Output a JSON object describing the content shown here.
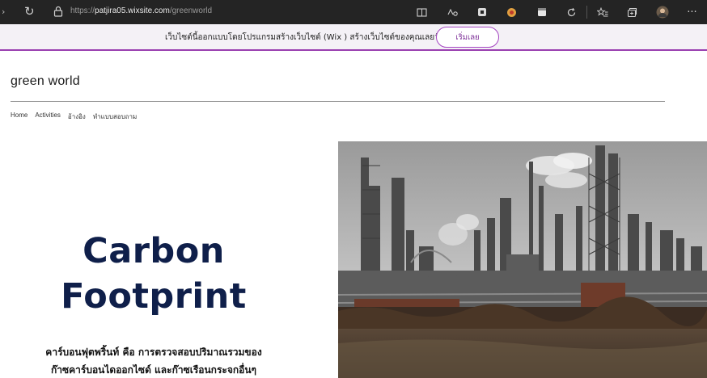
{
  "browser": {
    "url_scheme": "https://",
    "url_host": "patjira05.wixsite.com",
    "url_path": "/greenworld",
    "more_label": "···"
  },
  "wix_banner": {
    "text": "เว็บไซต์นี้ออกแบบโดยโปรแกรมสร้างเว็บไซต์ (Wix ) สร้างเว็บไซต์ของคุณเลยวันนี้",
    "button_label": "เริ่มเลย",
    "accent_color": "#a545c2"
  },
  "site": {
    "title": "green world",
    "nav": [
      "Home",
      "Activities",
      "อ้างอิง",
      "ทำแบบสอบถาม"
    ]
  },
  "hero": {
    "title_line1": "Carbon",
    "title_line2": "Footprint",
    "desc_line1": "คาร์บอนฟุตพริ้นท์ คือ การตรวจสอบปริมาณรวมของ",
    "desc_line2": "ก๊าซคาร์บอนไดออกไซด์ และก๊าซเรือนกระจกอื่นๆ",
    "title_color": "#0f1f4a"
  }
}
